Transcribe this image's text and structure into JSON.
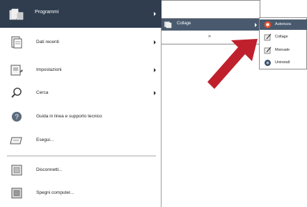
{
  "start_menu": {
    "programs": {
      "label": "Programmi",
      "icon": "programs-folder-icon"
    },
    "items": [
      {
        "name": "recent-items",
        "label": "Dati recenti",
        "icon": "recent-docs-icon",
        "submenu": true
      },
      {
        "name": "settings",
        "label": "Impostazioni",
        "icon": "settings-icon",
        "submenu": true
      },
      {
        "name": "search",
        "label": "Cerca",
        "icon": "search-icon",
        "submenu": true
      },
      {
        "name": "help",
        "label": "Guida in linea e supporto tecnico",
        "icon": "help-icon",
        "submenu": false
      },
      {
        "name": "run",
        "label": "Esegui...",
        "icon": "run-icon",
        "submenu": false
      },
      {
        "name": "logoff",
        "label": "Disconnetti...",
        "icon": "logoff-icon",
        "submenu": false
      },
      {
        "name": "shutdown",
        "label": "Spegni computer...",
        "icon": "shutdown-icon",
        "submenu": false
      }
    ]
  },
  "programs_submenu": {
    "collage": {
      "label": "Collage",
      "icon": "collage-folder-icon"
    },
    "more": "»"
  },
  "collage_submenu": {
    "items": [
      {
        "name": "avvio",
        "label": "Autorizza",
        "icon": "start-app-icon"
      },
      {
        "name": "collage",
        "label": "Collage",
        "icon": "collage-app-icon"
      },
      {
        "name": "manuale",
        "label": "Manuale",
        "icon": "manual-icon"
      },
      {
        "name": "uninstall",
        "label": "Uninstall",
        "icon": "uninstall-icon"
      }
    ]
  },
  "colors": {
    "highlight": "#2f3d4f",
    "arrow": "#c0202c"
  }
}
